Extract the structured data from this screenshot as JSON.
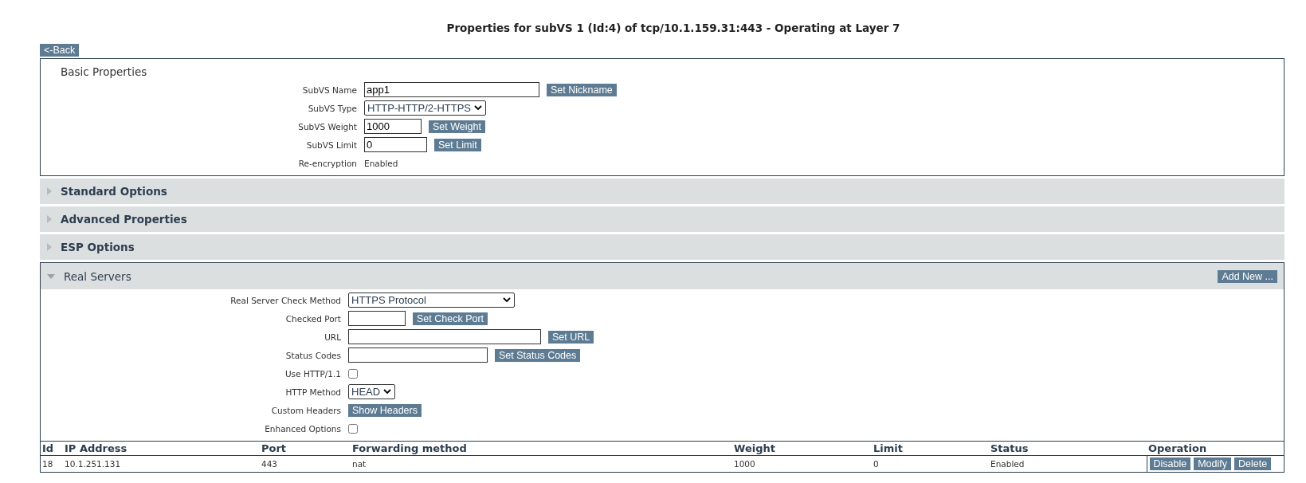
{
  "title": "Properties for subVS 1 (Id:4) of tcp/10.1.159.31:443 - Operating at Layer 7",
  "back_button": "<-Back",
  "basic_properties": {
    "title": "Basic Properties",
    "fields": [
      {
        "label": "SubVS Name",
        "kind": "text",
        "value": "app1",
        "button": "Set Nickname"
      },
      {
        "label": "SubVS Type",
        "kind": "select",
        "value": "HTTP-HTTP/2-HTTPS"
      },
      {
        "label": "SubVS Weight",
        "kind": "text",
        "value": "1000",
        "button": "Set Weight"
      },
      {
        "label": "SubVS Limit",
        "kind": "text",
        "value": "0",
        "button": "Set Limit"
      },
      {
        "label": "Re-encryption",
        "kind": "static",
        "value": "Enabled"
      }
    ]
  },
  "sections": [
    {
      "title": "Standard Options",
      "expanded": false
    },
    {
      "title": "Advanced Properties",
      "expanded": false
    },
    {
      "title": "ESP Options",
      "expanded": false
    }
  ],
  "real_servers": {
    "title": "Real Servers",
    "expanded": true,
    "add_button": "Add New ...",
    "fields": [
      {
        "label": "Real Server Check Method",
        "kind": "select",
        "value": "HTTPS Protocol"
      },
      {
        "label": "Checked Port",
        "kind": "text",
        "button": "Set Check Port"
      },
      {
        "label": "URL",
        "kind": "text",
        "button": "Set URL"
      },
      {
        "label": "Status Codes",
        "kind": "text",
        "button": "Set Status Codes"
      },
      {
        "label": "Use HTTP/1.1",
        "kind": "checkbox",
        "checked": false
      },
      {
        "label": "HTTP Method",
        "kind": "select",
        "value": "HEAD"
      },
      {
        "label": "Custom Headers",
        "kind": "button",
        "button": "Show Headers"
      },
      {
        "label": "Enhanced Options",
        "kind": "checkbox",
        "checked": false
      }
    ],
    "table": {
      "columns": [
        "Id",
        "IP Address",
        "Port",
        "Forwarding method",
        "Weight",
        "Limit",
        "Status",
        "Operation"
      ],
      "rows": [
        {
          "cells": [
            "18",
            "10.1.251.131",
            "443",
            "nat",
            "1000",
            "0",
            "Enabled"
          ],
          "operations": [
            "Disable",
            "Modify",
            "Delete"
          ]
        }
      ]
    }
  }
}
